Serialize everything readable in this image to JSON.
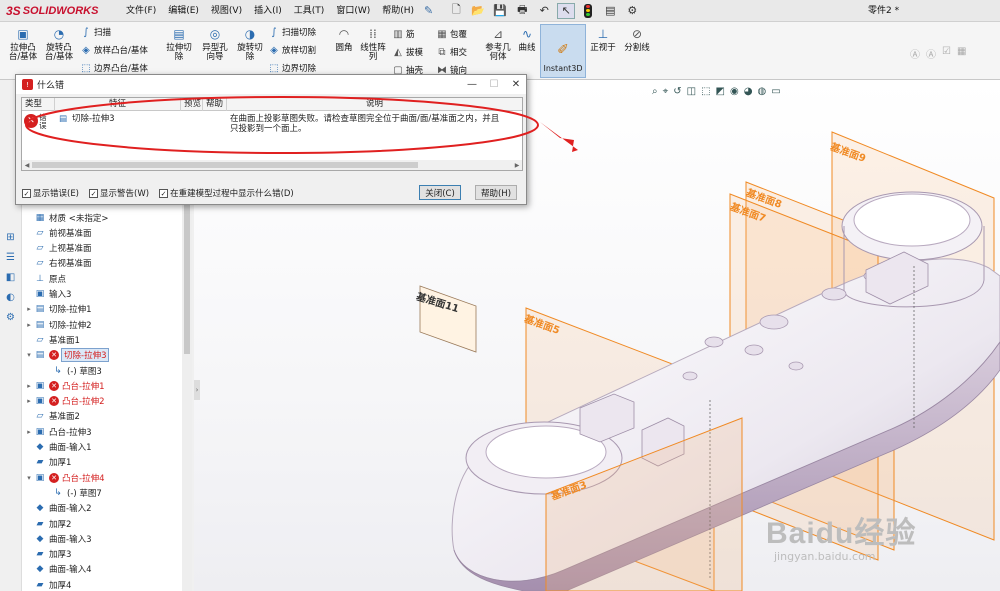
{
  "app": {
    "brand": "SOLIDWORKS",
    "brand_mark": "3S",
    "document_title": "零件2 *"
  },
  "menu": {
    "items": [
      "文件(F)",
      "编辑(E)",
      "视图(V)",
      "插入(I)",
      "工具(T)",
      "窗口(W)",
      "帮助(H)"
    ]
  },
  "ribbon": {
    "extrude_boss": "拉伸凸\n台/基体",
    "revolve_boss": "旋转凸\n台/基体",
    "sweep": "扫描",
    "loft": "放样凸台/基体",
    "boundary_boss": "边界凸台/基体",
    "extrude_cut": "拉伸切\n除",
    "hole_wizard": "异型孔\n向导",
    "revolve_cut": "旋转切\n除",
    "swept_cut": "扫描切除",
    "lofted_cut": "放样切割",
    "boundary_cut": "边界切除",
    "fillet": "圆角",
    "linear_pattern": "线性阵\n列",
    "rib": "筋",
    "draft": "拔模",
    "shell": "抽壳",
    "wrap": "包覆",
    "intersect": "相交",
    "mirror": "镜向",
    "reference_geometry": "参考几\n何体",
    "curves": "曲线",
    "instant3d": "Instant3D",
    "normal_to": "正视于",
    "split_line": "分割线"
  },
  "tree": {
    "items": [
      {
        "label": "材质 <未指定>",
        "icon": "material-icon",
        "indent": 0,
        "expand": "",
        "state": "normal"
      },
      {
        "label": "前视基准面",
        "icon": "plane-icon",
        "indent": 0,
        "expand": "",
        "state": "normal"
      },
      {
        "label": "上视基准面",
        "icon": "plane-icon",
        "indent": 0,
        "expand": "",
        "state": "normal"
      },
      {
        "label": "右视基准面",
        "icon": "plane-icon",
        "indent": 0,
        "expand": "",
        "state": "normal"
      },
      {
        "label": "原点",
        "icon": "origin-icon",
        "indent": 0,
        "expand": "",
        "state": "normal"
      },
      {
        "label": "输入3",
        "icon": "import-icon",
        "indent": 0,
        "expand": "",
        "state": "normal"
      },
      {
        "label": "切除-拉伸1",
        "icon": "cut-icon",
        "indent": 0,
        "expand": "▸",
        "state": "normal"
      },
      {
        "label": "切除-拉伸2",
        "icon": "cut-icon",
        "indent": 0,
        "expand": "▸",
        "state": "normal"
      },
      {
        "label": "基准面1",
        "icon": "plane-icon",
        "indent": 0,
        "expand": "",
        "state": "normal"
      },
      {
        "label": "切除-拉伸3",
        "icon": "cut-icon",
        "indent": 0,
        "expand": "▾",
        "state": "error-selected"
      },
      {
        "label": "(-) 草图3",
        "icon": "sketch-icon",
        "indent": 1,
        "expand": "",
        "state": "normal"
      },
      {
        "label": "凸台-拉伸1",
        "icon": "boss-icon",
        "indent": 0,
        "expand": "▸",
        "state": "error"
      },
      {
        "label": "凸台-拉伸2",
        "icon": "boss-icon",
        "indent": 0,
        "expand": "▸",
        "state": "error"
      },
      {
        "label": "基准面2",
        "icon": "plane-icon",
        "indent": 0,
        "expand": "",
        "state": "normal"
      },
      {
        "label": "凸台-拉伸3",
        "icon": "boss-icon",
        "indent": 0,
        "expand": "▸",
        "state": "normal"
      },
      {
        "label": "曲面-输入1",
        "icon": "surface-icon",
        "indent": 0,
        "expand": "",
        "state": "normal"
      },
      {
        "label": "加厚1",
        "icon": "thicken-icon",
        "indent": 0,
        "expand": "",
        "state": "normal"
      },
      {
        "label": "凸台-拉伸4",
        "icon": "boss-icon",
        "indent": 0,
        "expand": "▾",
        "state": "error"
      },
      {
        "label": "(-) 草图7",
        "icon": "sketch-icon",
        "indent": 1,
        "expand": "",
        "state": "normal"
      },
      {
        "label": "曲面-输入2",
        "icon": "surface-icon",
        "indent": 0,
        "expand": "",
        "state": "normal"
      },
      {
        "label": "加厚2",
        "icon": "thicken-icon",
        "indent": 0,
        "expand": "",
        "state": "normal"
      },
      {
        "label": "曲面-输入3",
        "icon": "surface-icon",
        "indent": 0,
        "expand": "",
        "state": "normal"
      },
      {
        "label": "加厚3",
        "icon": "thicken-icon",
        "indent": 0,
        "expand": "",
        "state": "normal"
      },
      {
        "label": "曲面-输入4",
        "icon": "surface-icon",
        "indent": 0,
        "expand": "",
        "state": "normal"
      },
      {
        "label": "加厚4",
        "icon": "thicken-icon",
        "indent": 0,
        "expand": "",
        "state": "normal"
      }
    ]
  },
  "viewport": {
    "plane_labels": [
      "基准面11",
      "基准面9",
      "基准面8",
      "基准面7",
      "基准面5",
      "基准面3"
    ],
    "watermark": "Baidu经验",
    "watermark_url": "jingyan.baidu.com"
  },
  "dialog": {
    "title": "什么错",
    "columns": [
      "类型",
      "特征",
      "预览",
      "帮助",
      "说明"
    ],
    "row": {
      "type": "错误",
      "feature": "切除-拉伸3",
      "description_line1": "在曲面上投影草图失败。请检查草图完全位于曲面/面/基准面之内，并且",
      "description_line2": "只投影到一个面上。"
    },
    "options": {
      "show_errors": "显示错误(E)",
      "show_warnings": "显示警告(W)",
      "show_on_rebuild": "在重建模型过程中显示什么错(D)"
    },
    "close_label": "关闭(C)",
    "help_label": "帮助(H)"
  },
  "colors": {
    "error_red": "#d42020",
    "plane_orange": "#f08a24",
    "brand_red": "#c8102e",
    "annotation_red": "#e02020"
  }
}
